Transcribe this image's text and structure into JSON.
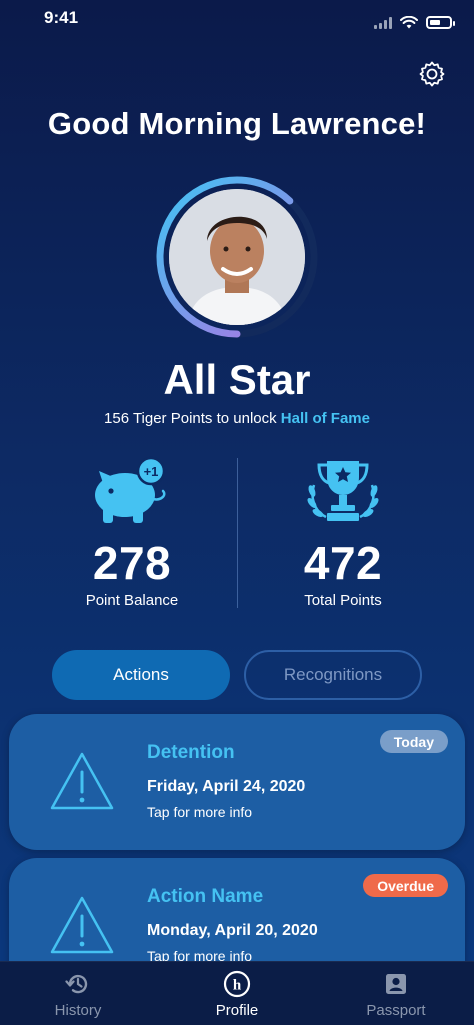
{
  "status_bar": {
    "time": "9:41"
  },
  "header": {
    "greeting": "Good Morning Lawrence!",
    "settings_icon": "gear-icon"
  },
  "profile": {
    "rank": "All Star",
    "unlock_prefix": "156 Tiger Points to unlock",
    "unlock_target": "Hall of Fame",
    "progress_fraction": 0.62
  },
  "stats": [
    {
      "icon": "piggy-bank-icon",
      "value": "278",
      "label": "Point Balance"
    },
    {
      "icon": "trophy-icon",
      "value": "472",
      "label": "Total Points"
    }
  ],
  "tabs": [
    {
      "label": "Actions",
      "active": true
    },
    {
      "label": "Recognitions",
      "active": false
    }
  ],
  "cards": [
    {
      "icon": "warning-icon",
      "title": "Detention",
      "date": "Friday, April 24, 2020",
      "hint": "Tap for more info",
      "badge": "Today"
    },
    {
      "icon": "warning-icon",
      "title": "Action Name",
      "date": "Monday, April 20, 2020",
      "hint": "Tap for more info",
      "badge": "Overdue"
    }
  ],
  "nav": [
    {
      "icon": "history-icon",
      "label": "History"
    },
    {
      "icon": "profile-h-icon",
      "label": "Profile"
    },
    {
      "icon": "passport-icon",
      "label": "Passport"
    }
  ],
  "colors": {
    "accent": "#45c2f2",
    "overdue": "#ef6a4a",
    "today": "#7a9ec9"
  }
}
